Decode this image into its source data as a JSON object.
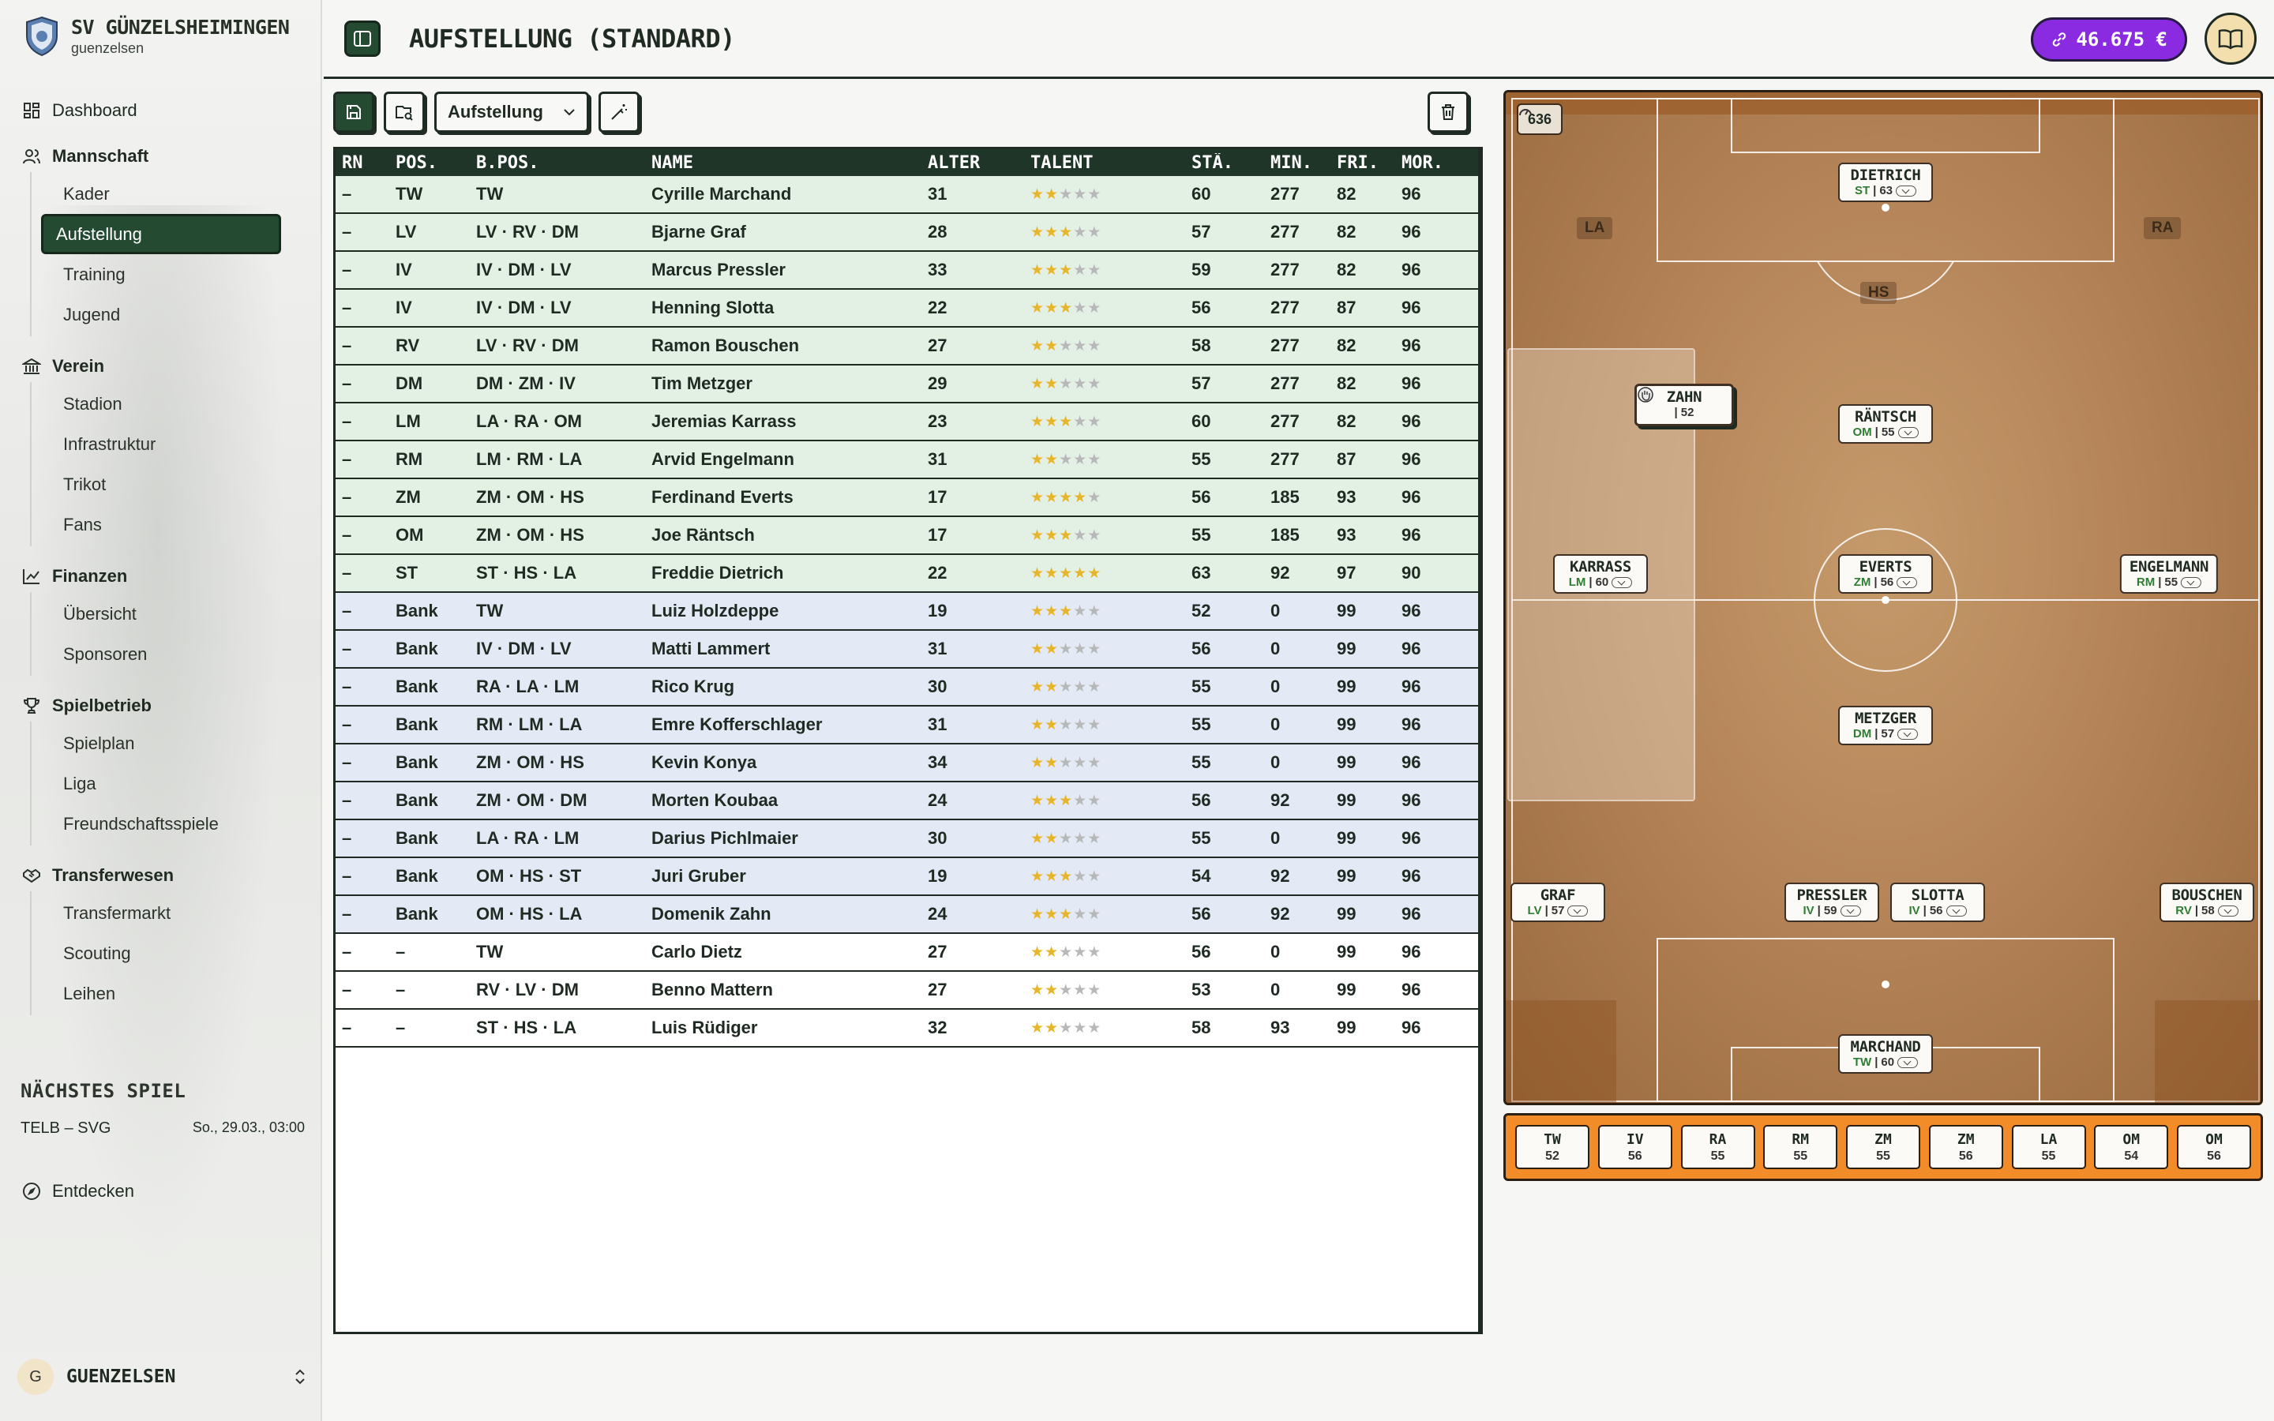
{
  "club": {
    "name": "SV GÜNZELSHEIMINGEN",
    "user": "guenzelsen"
  },
  "colors": {
    "accent": "#244a32",
    "money_bg": "#8a2be2",
    "bench_bg": "#f28c28",
    "star_on": "#e6b52c"
  },
  "nav": {
    "dashboard": "Dashboard",
    "sections": [
      {
        "label": "Mannschaft",
        "icon": "users-icon",
        "items": [
          "Kader",
          "Aufstellung",
          "Training",
          "Jugend"
        ]
      },
      {
        "label": "Verein",
        "icon": "building-icon",
        "items": [
          "Stadion",
          "Infrastruktur",
          "Trikot",
          "Fans"
        ]
      },
      {
        "label": "Finanzen",
        "icon": "chart-icon",
        "items": [
          "Übersicht",
          "Sponsoren"
        ]
      },
      {
        "label": "Spielbetrieb",
        "icon": "trophy-icon",
        "items": [
          "Spielplan",
          "Liga",
          "Freundschaftsspiele"
        ]
      },
      {
        "label": "Transferwesen",
        "icon": "handshake-icon",
        "items": [
          "Transfermarkt",
          "Scouting",
          "Leihen"
        ]
      }
    ],
    "active": "Aufstellung"
  },
  "next_match": {
    "heading": "NÄCHSTES SPIEL",
    "teams": "TELB – SVG",
    "date": "So., 29.03., 03:00"
  },
  "discover": "Entdecken",
  "user": {
    "initial": "G",
    "name": "GUENZELSEN"
  },
  "header": {
    "title": "AUFSTELLUNG (STANDARD)",
    "money": "46.675 €"
  },
  "toolbar": {
    "select_value": "Aufstellung"
  },
  "table": {
    "columns": [
      "RN",
      "POS.",
      "B.POS.",
      "NAME",
      "ALTER",
      "TALENT",
      "STÄ.",
      "MIN.",
      "FRI.",
      "MOR."
    ],
    "rows": [
      {
        "rn": "–",
        "pos": "TW",
        "bpos": "TW",
        "name": "Cyrille Marchand",
        "alter": "31",
        "talent": 2,
        "sta": "60",
        "min": "277",
        "fri": "82",
        "mor": "96",
        "group": "start"
      },
      {
        "rn": "–",
        "pos": "LV",
        "bpos": "LV · RV · DM",
        "name": "Bjarne Graf",
        "alter": "28",
        "talent": 3,
        "sta": "57",
        "min": "277",
        "fri": "82",
        "mor": "96",
        "group": "start"
      },
      {
        "rn": "–",
        "pos": "IV",
        "bpos": "IV · DM · LV",
        "name": "Marcus Pressler",
        "alter": "33",
        "talent": 3,
        "sta": "59",
        "min": "277",
        "fri": "82",
        "mor": "96",
        "group": "start"
      },
      {
        "rn": "–",
        "pos": "IV",
        "bpos": "IV · DM · LV",
        "name": "Henning Slotta",
        "alter": "22",
        "talent": 3,
        "sta": "56",
        "min": "277",
        "fri": "87",
        "mor": "96",
        "group": "start"
      },
      {
        "rn": "–",
        "pos": "RV",
        "bpos": "LV · RV · DM",
        "name": "Ramon Bouschen",
        "alter": "27",
        "talent": 2,
        "sta": "58",
        "min": "277",
        "fri": "82",
        "mor": "96",
        "group": "start"
      },
      {
        "rn": "–",
        "pos": "DM",
        "bpos": "DM · ZM · IV",
        "name": "Tim Metzger",
        "alter": "29",
        "talent": 2,
        "sta": "57",
        "min": "277",
        "fri": "82",
        "mor": "96",
        "group": "start"
      },
      {
        "rn": "–",
        "pos": "LM",
        "bpos": "LA · RA · OM",
        "name": "Jeremias Karrass",
        "alter": "23",
        "talent": 3,
        "sta": "60",
        "min": "277",
        "fri": "82",
        "mor": "96",
        "group": "start"
      },
      {
        "rn": "–",
        "pos": "RM",
        "bpos": "LM · RM · LA",
        "name": "Arvid Engelmann",
        "alter": "31",
        "talent": 2,
        "sta": "55",
        "min": "277",
        "fri": "87",
        "mor": "96",
        "group": "start"
      },
      {
        "rn": "–",
        "pos": "ZM",
        "bpos": "ZM · OM · HS",
        "name": "Ferdinand Everts",
        "alter": "17",
        "talent": 4,
        "sta": "56",
        "min": "185",
        "fri": "93",
        "mor": "96",
        "group": "start"
      },
      {
        "rn": "–",
        "pos": "OM",
        "bpos": "ZM · OM · HS",
        "name": "Joe Räntsch",
        "alter": "17",
        "talent": 3,
        "sta": "55",
        "min": "185",
        "fri": "93",
        "mor": "96",
        "group": "start"
      },
      {
        "rn": "–",
        "pos": "ST",
        "bpos": "ST · HS · LA",
        "name": "Freddie Dietrich",
        "alter": "22",
        "talent": 5,
        "sta": "63",
        "min": "92",
        "fri": "97",
        "mor": "90",
        "group": "start"
      },
      {
        "rn": "–",
        "pos": "Bank",
        "bpos": "TW",
        "name": "Luiz Holzdeppe",
        "alter": "19",
        "talent": 3,
        "sta": "52",
        "min": "0",
        "fri": "99",
        "mor": "96",
        "group": "bank"
      },
      {
        "rn": "–",
        "pos": "Bank",
        "bpos": "IV · DM · LV",
        "name": "Matti Lammert",
        "alter": "31",
        "talent": 2,
        "sta": "56",
        "min": "0",
        "fri": "99",
        "mor": "96",
        "group": "bank"
      },
      {
        "rn": "–",
        "pos": "Bank",
        "bpos": "RA · LA · LM",
        "name": "Rico Krug",
        "alter": "30",
        "talent": 2,
        "sta": "55",
        "min": "0",
        "fri": "99",
        "mor": "96",
        "group": "bank"
      },
      {
        "rn": "–",
        "pos": "Bank",
        "bpos": "RM · LM · LA",
        "name": "Emre Kofferschlager",
        "alter": "31",
        "talent": 2,
        "sta": "55",
        "min": "0",
        "fri": "99",
        "mor": "96",
        "group": "bank"
      },
      {
        "rn": "–",
        "pos": "Bank",
        "bpos": "ZM · OM · HS",
        "name": "Kevin Konya",
        "alter": "34",
        "talent": 2,
        "sta": "55",
        "min": "0",
        "fri": "99",
        "mor": "96",
        "group": "bank"
      },
      {
        "rn": "–",
        "pos": "Bank",
        "bpos": "ZM · OM · DM",
        "name": "Morten Koubaa",
        "alter": "24",
        "talent": 3,
        "sta": "56",
        "min": "92",
        "fri": "99",
        "mor": "96",
        "group": "bank"
      },
      {
        "rn": "–",
        "pos": "Bank",
        "bpos": "LA · RA · LM",
        "name": "Darius Pichlmaier",
        "alter": "30",
        "talent": 2,
        "sta": "55",
        "min": "0",
        "fri": "99",
        "mor": "96",
        "group": "bank"
      },
      {
        "rn": "–",
        "pos": "Bank",
        "bpos": "OM · HS · ST",
        "name": "Juri Gruber",
        "alter": "19",
        "talent": 3,
        "sta": "54",
        "min": "92",
        "fri": "99",
        "mor": "96",
        "group": "bank"
      },
      {
        "rn": "–",
        "pos": "Bank",
        "bpos": "OM · HS · LA",
        "name": "Domenik Zahn",
        "alter": "24",
        "talent": 3,
        "sta": "56",
        "min": "92",
        "fri": "99",
        "mor": "96",
        "group": "bank"
      },
      {
        "rn": "–",
        "pos": "–",
        "bpos": "TW",
        "name": "Carlo Dietz",
        "alter": "27",
        "talent": 2,
        "sta": "56",
        "min": "0",
        "fri": "99",
        "mor": "96",
        "group": "res"
      },
      {
        "rn": "–",
        "pos": "–",
        "bpos": "RV · LV · DM",
        "name": "Benno Mattern",
        "alter": "27",
        "talent": 2,
        "sta": "53",
        "min": "0",
        "fri": "99",
        "mor": "96",
        "group": "res"
      },
      {
        "rn": "–",
        "pos": "–",
        "bpos": "ST · HS · LA",
        "name": "Luis Rüdiger",
        "alter": "32",
        "talent": 2,
        "sta": "58",
        "min": "93",
        "fri": "99",
        "mor": "96",
        "group": "res"
      }
    ]
  },
  "pitch": {
    "counter": "636",
    "zones": [
      "LA",
      "RA",
      "HS"
    ],
    "players": [
      {
        "name": "DIETRICH",
        "pos": "ST",
        "rating": "63"
      },
      {
        "name": "RÄNTSCH",
        "pos": "OM",
        "rating": "55"
      },
      {
        "name": "KARRASS",
        "pos": "LM",
        "rating": "60"
      },
      {
        "name": "EVERTS",
        "pos": "ZM",
        "rating": "56"
      },
      {
        "name": "ENGELMANN",
        "pos": "RM",
        "rating": "55"
      },
      {
        "name": "METZGER",
        "pos": "DM",
        "rating": "57"
      },
      {
        "name": "GRAF",
        "pos": "LV",
        "rating": "57"
      },
      {
        "name": "PRESSLER",
        "pos": "IV",
        "rating": "59"
      },
      {
        "name": "SLOTTA",
        "pos": "IV",
        "rating": "56"
      },
      {
        "name": "BOUSCHEN",
        "pos": "RV",
        "rating": "58"
      },
      {
        "name": "MARCHAND",
        "pos": "TW",
        "rating": "60"
      }
    ],
    "dragging": {
      "name": "ZAHN",
      "rating": "52"
    }
  },
  "bench": [
    {
      "pos": "TW",
      "rating": "52"
    },
    {
      "pos": "IV",
      "rating": "56"
    },
    {
      "pos": "RA",
      "rating": "55"
    },
    {
      "pos": "RM",
      "rating": "55"
    },
    {
      "pos": "ZM",
      "rating": "55"
    },
    {
      "pos": "ZM",
      "rating": "56"
    },
    {
      "pos": "LA",
      "rating": "55"
    },
    {
      "pos": "OM",
      "rating": "54"
    },
    {
      "pos": "OM",
      "rating": "56"
    }
  ]
}
